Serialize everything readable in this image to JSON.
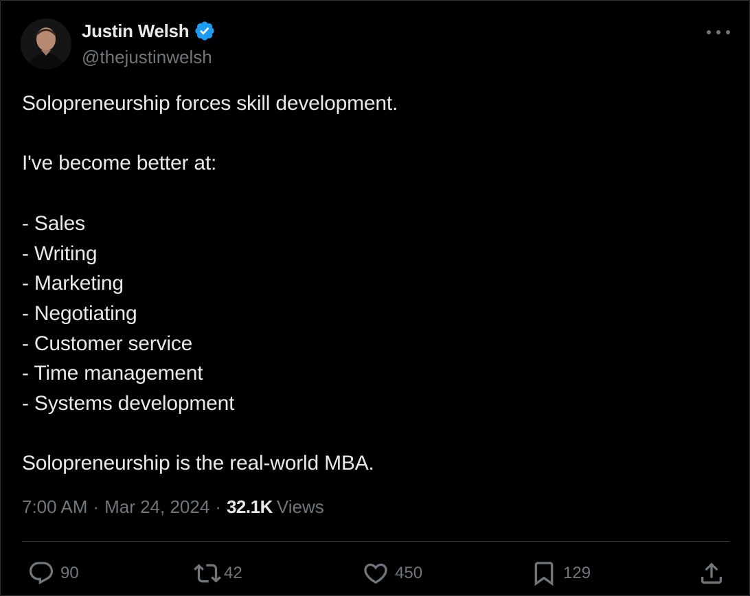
{
  "author": {
    "display_name": "Justin Welsh",
    "handle": "@thejustinwelsh",
    "verified_icon": "verified-badge-icon"
  },
  "tweet": {
    "text": "Solopreneurship forces skill development.\n\nI've become better at:\n\n- Sales\n- Writing\n- Marketing\n- Negotiating\n- Customer service\n- Time management\n- Systems development\n\nSolopreneurship is the real-world MBA.",
    "time": "7:00 AM",
    "date": "Mar 24, 2024",
    "views_count": "32.1K",
    "views_label": "Views"
  },
  "actions": {
    "replies": "90",
    "reposts": "42",
    "likes": "450",
    "bookmarks": "129"
  },
  "icons": {
    "more": "more-options-icon",
    "reply": "reply-icon",
    "repost": "repost-icon",
    "like": "heart-icon",
    "bookmark": "bookmark-icon",
    "share": "share-icon"
  },
  "colors": {
    "background": "#000000",
    "text_primary": "#e7e9ea",
    "text_secondary": "#71767b",
    "verified": "#1d9bf0",
    "divider": "#2f3336"
  }
}
